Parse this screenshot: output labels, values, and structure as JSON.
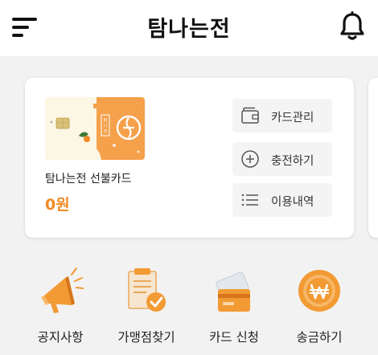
{
  "header": {
    "title": "탐나는전",
    "menu_icon": "hamburger-menu-icon",
    "bell_icon": "bell-icon"
  },
  "card": {
    "name": "탐나는전 선불카드",
    "balance": "0원",
    "image_text": "탐나는전",
    "actions": [
      {
        "label": "카드관리",
        "icon": "wallet-icon"
      },
      {
        "label": "충전하기",
        "icon": "plus-circle-icon"
      },
      {
        "label": "이용내역",
        "icon": "list-icon"
      }
    ]
  },
  "menu": [
    {
      "label": "공지사항",
      "icon": "megaphone-icon"
    },
    {
      "label": "가맹점찾기",
      "icon": "store-search-icon"
    },
    {
      "label": "카드 신청",
      "icon": "card-apply-icon"
    },
    {
      "label": "송금하기",
      "icon": "won-coin-icon"
    }
  ],
  "colors": {
    "accent": "#f08a24",
    "background": "#f2f2f2",
    "card_orange": "#f5a04a"
  }
}
